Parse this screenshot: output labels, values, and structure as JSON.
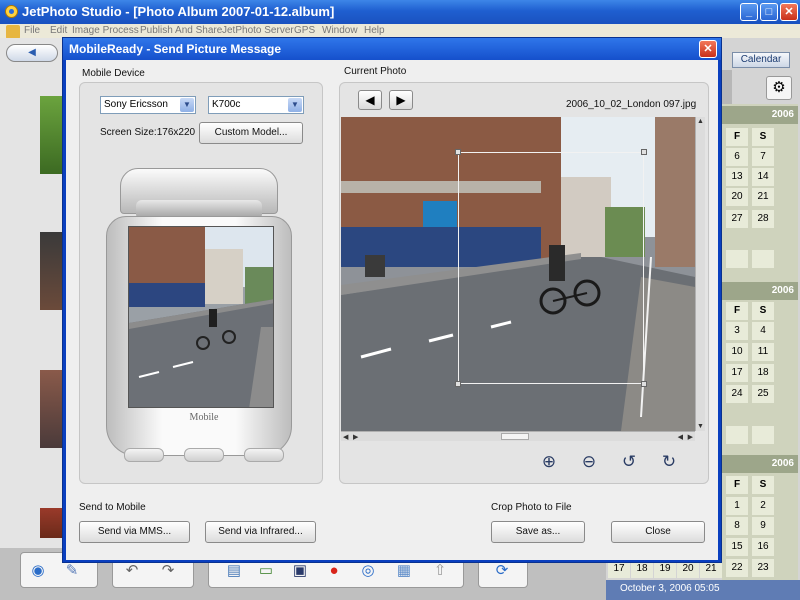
{
  "app": {
    "title": "JetPhoto Studio - [Photo Album 2007-01-12.album]",
    "menu": [
      "File",
      "Edit",
      "Image Process",
      "Publish And Share",
      "JetPhoto Server",
      "GPS",
      "Window",
      "Help"
    ],
    "minimize": "_",
    "maximize": "□",
    "close": "✕",
    "back_label": "◀"
  },
  "calendar": {
    "tab_label": "Calendar",
    "months": [
      {
        "year": "2006",
        "headers": [
          "F",
          "S"
        ],
        "rows": [
          [
            "6",
            "7"
          ],
          [
            "13",
            "14"
          ],
          [
            "20",
            "21"
          ],
          [
            "27",
            "28"
          ],
          [
            "",
            ""
          ]
        ]
      },
      {
        "year": "2006",
        "headers": [
          "F",
          "S"
        ],
        "rows": [
          [
            "3",
            "4"
          ],
          [
            "10",
            "11"
          ],
          [
            "17",
            "18"
          ],
          [
            "24",
            "25"
          ],
          [
            "",
            ""
          ]
        ]
      },
      {
        "year": "2006",
        "headers": [
          "F",
          "S"
        ],
        "rows": [
          [
            "1",
            "2"
          ],
          [
            "8",
            "9"
          ],
          [
            "15",
            "16"
          ],
          [
            "22",
            "23"
          ]
        ]
      }
    ],
    "bottom_row": [
      "17",
      "18",
      "19",
      "20",
      "21"
    ],
    "status_date": "October 3, 2006 05:05"
  },
  "dialog": {
    "title": "MobileReady - Send Picture Message",
    "close": "✕",
    "mobile_device_label": "Mobile Device",
    "brand_value": "Sony Ericsson",
    "model_value": "K700c",
    "screen_size": "Screen Size:176x220",
    "custom_model_button": "Custom Model...",
    "phone_brand": "Mobile",
    "current_photo_label": "Current Photo",
    "prev": "◀",
    "next": "▶",
    "filename": "2006_10_02_London 097.jpg",
    "send_to_mobile_label": "Send to Mobile",
    "send_mms_button": "Send via MMS...",
    "send_infrared_button": "Send via Infrared...",
    "crop_photo_label": "Crop Photo to File",
    "save_as_button": "Save as...",
    "close_button": "Close",
    "tools": {
      "zoom_in": "⊕",
      "zoom_out": "⊖",
      "rotate_left": "↺",
      "rotate_right": "↻"
    }
  },
  "colors": {
    "titlebar": "#1f5fd0",
    "dialog_frame": "#0a3fbf",
    "calendar_header": "#9da68a",
    "status_bar": "#5f7cb4"
  }
}
